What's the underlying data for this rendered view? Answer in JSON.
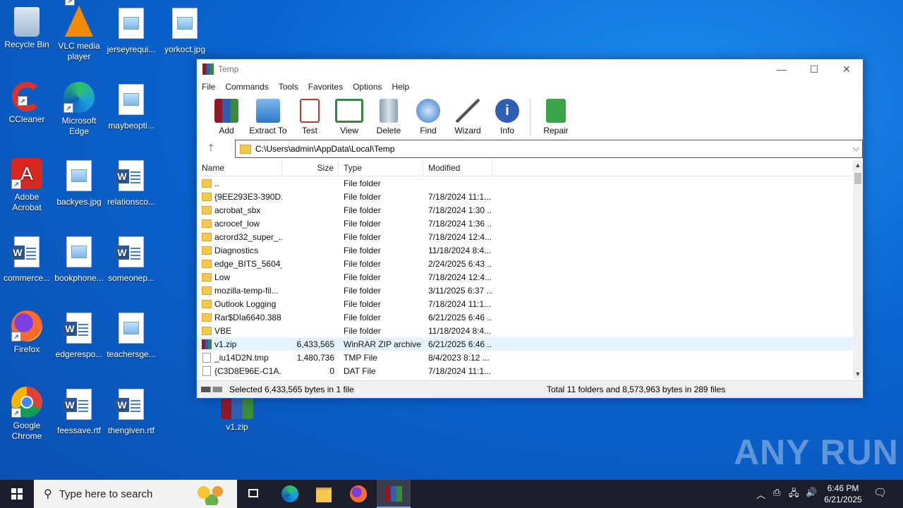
{
  "desktop": {
    "icons": [
      {
        "label": "Recycle Bin"
      },
      {
        "label": "VLC media player"
      },
      {
        "label": "jerseyrequi..."
      },
      {
        "label": "yorkoct.jpg"
      },
      {
        "label": "CCleaner"
      },
      {
        "label": "Microsoft Edge"
      },
      {
        "label": "maybeopti..."
      },
      {
        "label": "Adobe Acrobat"
      },
      {
        "label": "backyes.jpg"
      },
      {
        "label": "relationsco..."
      },
      {
        "label": "commerce..."
      },
      {
        "label": "bookphone..."
      },
      {
        "label": "someonep..."
      },
      {
        "label": "Firefox"
      },
      {
        "label": "edgerespo..."
      },
      {
        "label": "teachersge..."
      },
      {
        "label": "Google Chrome"
      },
      {
        "label": "feessave.rtf"
      },
      {
        "label": "thengiven.rtf"
      },
      {
        "label": "v1.zip"
      }
    ]
  },
  "window": {
    "title": "Temp",
    "menu": [
      "File",
      "Commands",
      "Tools",
      "Favorites",
      "Options",
      "Help"
    ],
    "toolbar": [
      "Add",
      "Extract To",
      "Test",
      "View",
      "Delete",
      "Find",
      "Wizard",
      "Info",
      "Repair"
    ],
    "path": "C:\\Users\\admin\\AppData\\Local\\Temp",
    "columns": [
      "Name",
      "Size",
      "Type",
      "Modified"
    ],
    "rows": [
      {
        "name": "..",
        "size": "",
        "type": "File folder",
        "modified": "",
        "icon": "folder"
      },
      {
        "name": "{9EE293E3-390D...",
        "size": "",
        "type": "File folder",
        "modified": "7/18/2024 11:1...",
        "icon": "folder"
      },
      {
        "name": "acrobat_sbx",
        "size": "",
        "type": "File folder",
        "modified": "7/18/2024 1:30 ...",
        "icon": "folder"
      },
      {
        "name": "acrocef_low",
        "size": "",
        "type": "File folder",
        "modified": "7/18/2024 1:36 ...",
        "icon": "folder"
      },
      {
        "name": "acrord32_super_...",
        "size": "",
        "type": "File folder",
        "modified": "7/18/2024 12:4...",
        "icon": "folder"
      },
      {
        "name": "Diagnostics",
        "size": "",
        "type": "File folder",
        "modified": "11/18/2024 8:4...",
        "icon": "folder"
      },
      {
        "name": "edge_BITS_5604_...",
        "size": "",
        "type": "File folder",
        "modified": "2/24/2025 6:43 ...",
        "icon": "folder"
      },
      {
        "name": "Low",
        "size": "",
        "type": "File folder",
        "modified": "7/18/2024 12:4...",
        "icon": "folder"
      },
      {
        "name": "mozilla-temp-fil...",
        "size": "",
        "type": "File folder",
        "modified": "3/11/2025 6:37 ...",
        "icon": "folder"
      },
      {
        "name": "Outlook Logging",
        "size": "",
        "type": "File folder",
        "modified": "7/18/2024 11:1...",
        "icon": "folder"
      },
      {
        "name": "Rar$DIa6640.388...",
        "size": "",
        "type": "File folder",
        "modified": "6/21/2025 6:46 ...",
        "icon": "folder"
      },
      {
        "name": "VBE",
        "size": "",
        "type": "File folder",
        "modified": "11/18/2024 8:4...",
        "icon": "folder"
      },
      {
        "name": "v1.zip",
        "size": "6,433,565",
        "type": "WinRAR ZIP archive",
        "modified": "6/21/2025 6:46 ...",
        "icon": "zip",
        "selected": true
      },
      {
        "name": "_iu14D2N.tmp",
        "size": "1,480,736",
        "type": "TMP File",
        "modified": "8/4/2023 8:12 ...",
        "icon": "file"
      },
      {
        "name": "{C3D8E96E-C1A...",
        "size": "0",
        "type": "DAT File",
        "modified": "7/18/2024 11:1...",
        "icon": "file"
      }
    ],
    "status_left": "Selected 6,433,565 bytes in 1 file",
    "status_right": "Total 11 folders and 8,573,963 bytes in 289 files"
  },
  "taskbar": {
    "search_placeholder": "Type here to search",
    "time": "6:46 PM",
    "date": "6/21/2025"
  },
  "watermark": "ANY RUN"
}
